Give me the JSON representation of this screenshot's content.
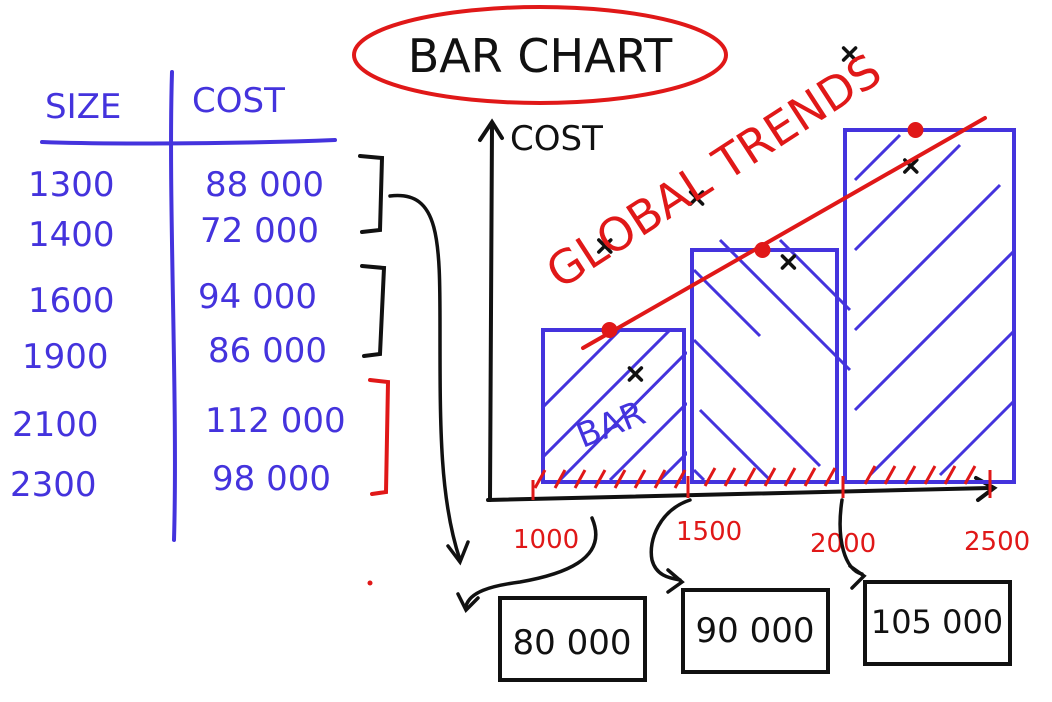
{
  "title": "BAR CHART",
  "table": {
    "headers": [
      "SIZE",
      "COST"
    ],
    "rows": [
      {
        "size": "1300",
        "cost": "88 000",
        "group": 1
      },
      {
        "size": "1400",
        "cost": "72 000",
        "group": 1
      },
      {
        "size": "1600",
        "cost": "94 000",
        "group": 2
      },
      {
        "size": "1900",
        "cost": "86 000",
        "group": 2
      },
      {
        "size": "2100",
        "cost": "112 000",
        "group": 3
      },
      {
        "size": "2300",
        "cost": "98 000",
        "group": 3
      }
    ]
  },
  "chart": {
    "ylabel": "COST",
    "bar_label": "BAR",
    "trend_label": "GLOBAL TRENDS",
    "x_ticks": [
      "1000",
      "1500",
      "2000",
      "2500"
    ],
    "bins": [
      {
        "from": 1000,
        "to": 1500,
        "avg": 80000,
        "avg_label": "80 000"
      },
      {
        "from": 1500,
        "to": 2000,
        "avg": 90000,
        "avg_label": "90 000"
      },
      {
        "from": 2000,
        "to": 2500,
        "avg": 105000,
        "avg_label": "105 000"
      }
    ],
    "points": [
      {
        "x": 1300,
        "y": 88000
      },
      {
        "x": 1400,
        "y": 72000
      },
      {
        "x": 1600,
        "y": 94000
      },
      {
        "x": 1900,
        "y": 86000
      },
      {
        "x": 2100,
        "y": 112000
      },
      {
        "x": 2300,
        "y": 98000
      }
    ]
  },
  "colors": {
    "ink_blue": "#4433dd",
    "ink_red": "#e01818",
    "ink_black": "#111111"
  }
}
